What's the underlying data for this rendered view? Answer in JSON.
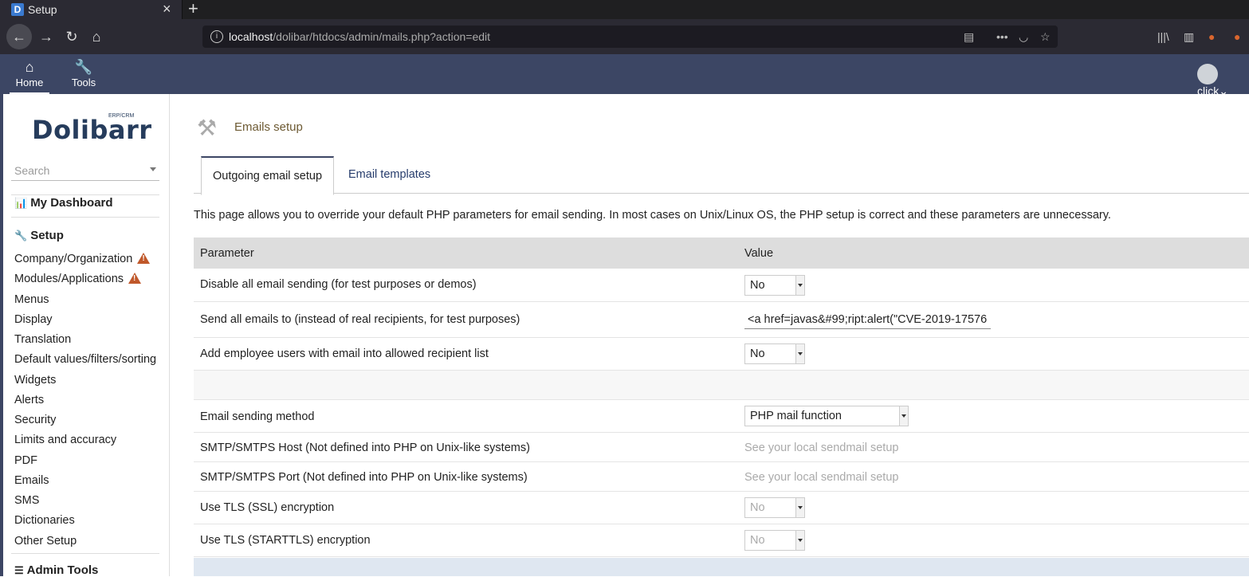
{
  "browser": {
    "tab_title": "Setup",
    "favicon_letter": "D",
    "url_host": "localhost",
    "url_path": "/dolibar/htdocs/admin/mails.php?action=edit"
  },
  "topmenu": {
    "home_label": "Home",
    "tools_label": "Tools",
    "user_label": "click"
  },
  "sidebar": {
    "logo_text": "Dolibarr",
    "logo_sub": "ERP/CRM",
    "search_placeholder": "Search",
    "dashboard_label": "My Dashboard",
    "setup_label": "Setup",
    "items": [
      {
        "label": "Company/Organization"
      },
      {
        "label": "Modules/Applications"
      },
      {
        "label": "Menus"
      },
      {
        "label": "Display"
      },
      {
        "label": "Translation"
      },
      {
        "label": "Default values/filters/sorting"
      },
      {
        "label": "Widgets"
      },
      {
        "label": "Alerts"
      },
      {
        "label": "Security"
      },
      {
        "label": "Limits and accuracy"
      },
      {
        "label": "PDF"
      },
      {
        "label": "Emails"
      },
      {
        "label": "SMS"
      },
      {
        "label": "Dictionaries"
      },
      {
        "label": "Other Setup"
      }
    ],
    "admin_tools_label": "Admin Tools"
  },
  "main": {
    "page_title": "Emails setup",
    "tabs": [
      {
        "label": "Outgoing email setup"
      },
      {
        "label": "Email templates"
      }
    ],
    "description": "This page allows you to override your default PHP parameters for email sending. In most cases on Unix/Linux OS, the PHP setup is correct and these parameters are unnecessary.",
    "table": {
      "header_param": "Parameter",
      "header_value": "Value",
      "rows": [
        {
          "label": "Disable all email sending (for test purposes or demos)",
          "value": "No"
        },
        {
          "label": "Send all emails to (instead of real recipients, for test purposes)",
          "value": "<a href=javas&#99;ript:alert(\"CVE-2019-17576"
        },
        {
          "label": "Add employee users with email into allowed recipient list",
          "value": "No"
        },
        {
          "label": "Email sending method",
          "value": "PHP mail function"
        },
        {
          "label": "SMTP/SMTPS Host (Not defined into PHP on Unix-like systems)",
          "value": "See your local sendmail setup"
        },
        {
          "label": "SMTP/SMTPS Port (Not defined into PHP on Unix-like systems)",
          "value": "See your local sendmail setup"
        },
        {
          "label": "Use TLS (SSL) encryption",
          "value": "No"
        },
        {
          "label": "Use TLS (STARTTLS) encryption",
          "value": "No"
        }
      ]
    }
  }
}
